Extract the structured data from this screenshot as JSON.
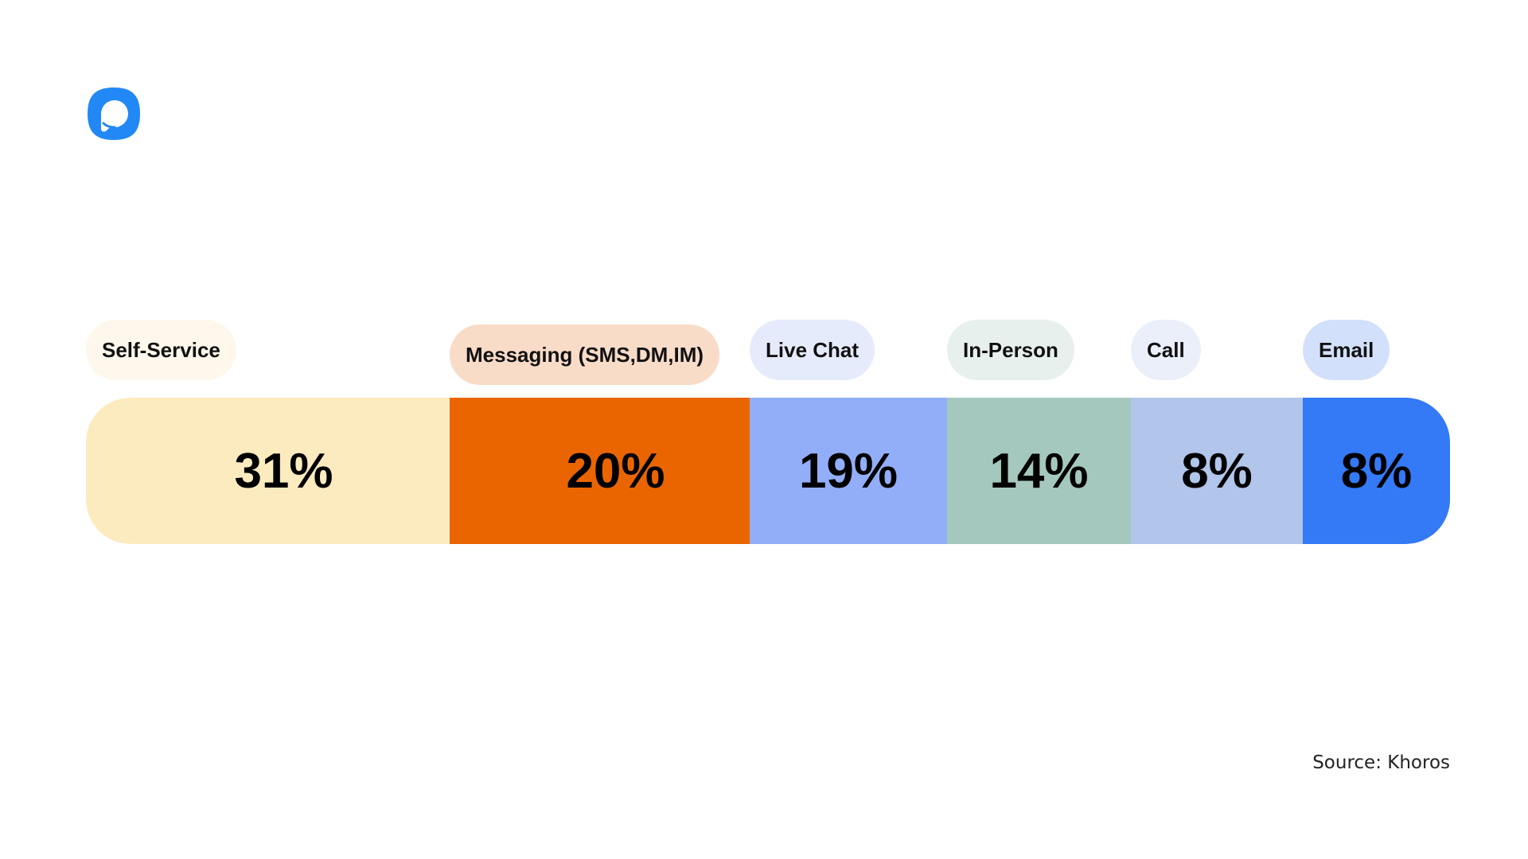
{
  "brand": {
    "logo_icon": "chat-bubble-logo-icon",
    "logo_color": "#2288f5"
  },
  "chart_data": {
    "type": "bar",
    "orientation": "horizontal-stacked",
    "title": "",
    "categories": [
      "Self-Service",
      "Messaging (SMS,DM,IM)",
      "Live Chat",
      "In-Person",
      "Call",
      "Email"
    ],
    "values": [
      31,
      20,
      19,
      14,
      8,
      8
    ],
    "data_labels": [
      "31%",
      "20%",
      "19%",
      "14%",
      "8%",
      "8%"
    ],
    "unit": "%",
    "colors": [
      "#fdebc0",
      "#ea6500",
      "#93aef8",
      "#a5c8be",
      "#b2c5ea",
      "#3479f5"
    ],
    "label_pill_colors": [
      "#fef8ec",
      "#f9dcc8",
      "#e6ebfc",
      "#e7f0ed",
      "#eaeffa",
      "#d2e0fb"
    ],
    "legend": "labels above segments",
    "grid": false
  },
  "source": "Source: Khoros"
}
